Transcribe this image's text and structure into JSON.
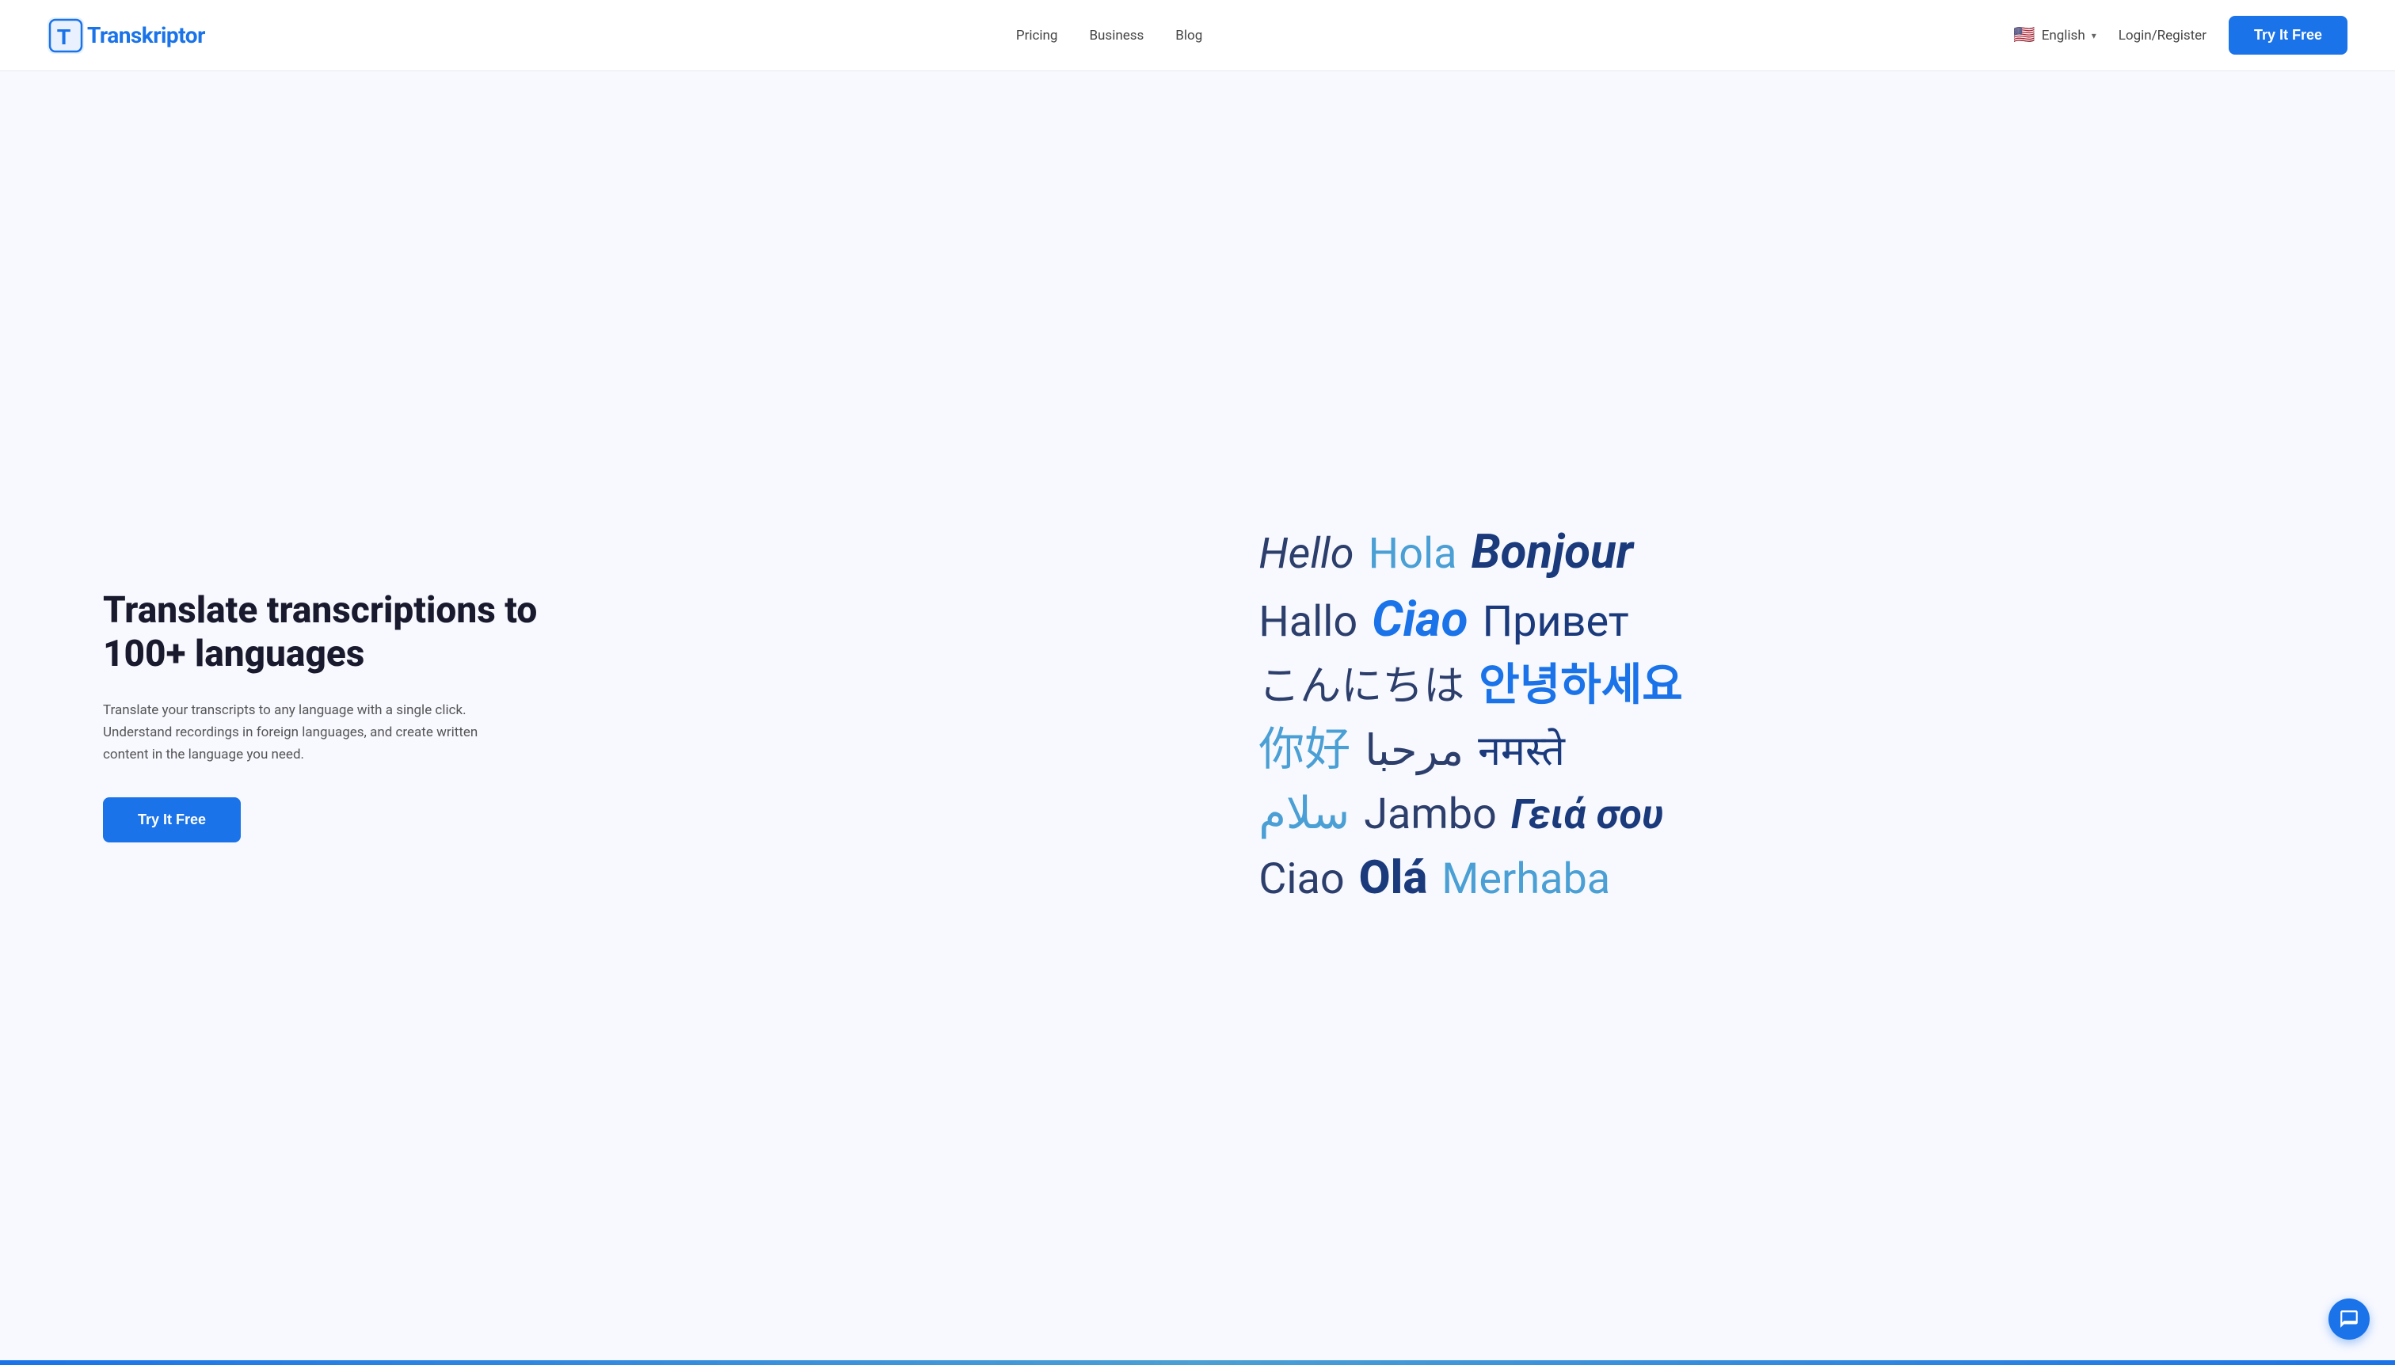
{
  "navbar": {
    "logo_text": "ranskriptor",
    "logo_letter": "T",
    "nav_items": [
      {
        "label": "Pricing",
        "href": "#"
      },
      {
        "label": "Business",
        "href": "#"
      },
      {
        "label": "Blog",
        "href": "#"
      }
    ],
    "language": {
      "label": "English",
      "flag_emoji": "🇺🇸"
    },
    "login_label": "Login/Register",
    "cta_label": "Try It Free"
  },
  "hero": {
    "title": "Translate transcriptions to 100+ languages",
    "description": "Translate your transcripts to any language with a single click. Understand recordings in foreign languages, and create written content in the language you need.",
    "cta_label": "Try It Free",
    "lang_cloud": {
      "row1": [
        "Hello",
        "Hola",
        "Bonjour"
      ],
      "row2": [
        "Hallo",
        "Ciao",
        "Привет"
      ],
      "row3": [
        "こんにちは",
        "안녕하세요"
      ],
      "row4": [
        "你好",
        "مرحبا",
        "नमस्ते"
      ],
      "row5": [
        "سلام",
        "Jambo",
        "Γειά σου"
      ],
      "row6": [
        "Ciao",
        "Olá",
        "Merhaba"
      ]
    }
  },
  "chat": {
    "label": "Open chat"
  }
}
